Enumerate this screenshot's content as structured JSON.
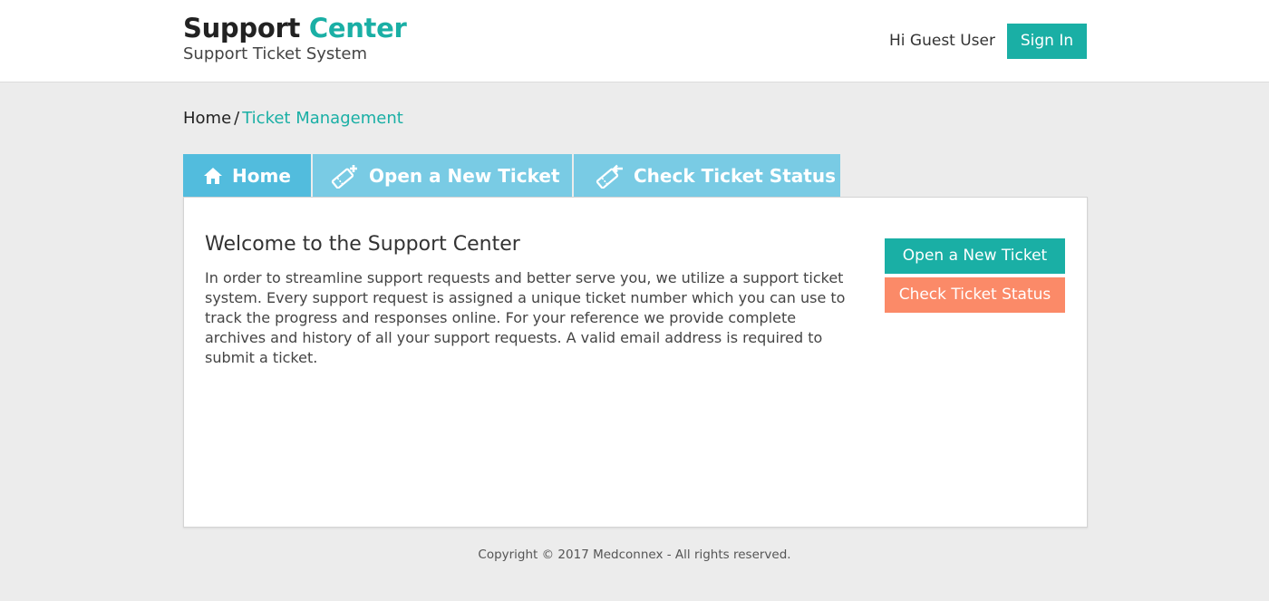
{
  "header": {
    "title_main": "Support",
    "title_accent": "Center",
    "subtitle": "Support Ticket System",
    "greeting": "Hi Guest User",
    "signin_label": "Sign In"
  },
  "breadcrumb": {
    "home": "Home",
    "separator": "/",
    "current": "Ticket Management"
  },
  "tabs": [
    {
      "label": "Home",
      "icon": "home-icon",
      "active": true
    },
    {
      "label": "Open a New Ticket",
      "icon": "ticket-add-icon",
      "active": false
    },
    {
      "label": "Check Ticket Status",
      "icon": "ticket-check-icon",
      "active": false
    }
  ],
  "main": {
    "title": "Welcome to the Support Center",
    "body": "In order to streamline support requests and better serve you, we utilize a support ticket system. Every support request is assigned a unique ticket number which you can use to track the progress and responses online. For your reference we provide complete archives and history of all your support requests. A valid email address is required to submit a ticket.",
    "open_ticket_label": "Open a New Ticket",
    "check_status_label": "Check Ticket Status"
  },
  "footer": {
    "copyright": "Copyright © 2017 Medconnex - All rights reserved."
  },
  "colors": {
    "accent": "#1aafa5",
    "tab_active": "#52bcdd",
    "tab_inactive": "#79cbe4",
    "orange": "#fb8a68",
    "background": "#ececec"
  }
}
